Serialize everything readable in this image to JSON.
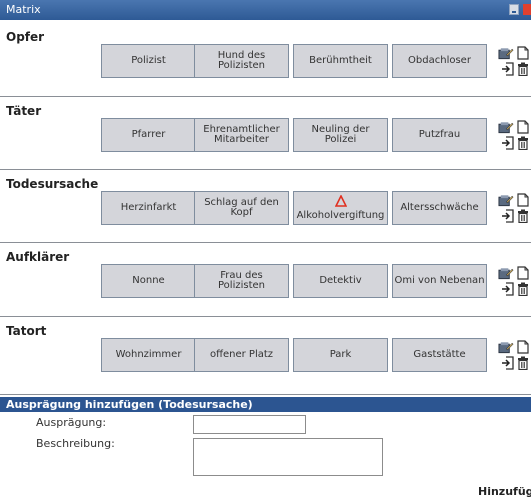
{
  "window": {
    "title": "Matrix"
  },
  "matrix": {
    "rows": [
      {
        "title": "Opfer",
        "items": [
          {
            "label": "Polizist"
          },
          {
            "label": "Hund des Polizisten"
          },
          {
            "label": "Berühmtheit"
          },
          {
            "label": "Obdachloser"
          }
        ]
      },
      {
        "title": "Täter",
        "items": [
          {
            "label": "Pfarrer"
          },
          {
            "label": "Ehrenamtlicher Mitarbeiter"
          },
          {
            "label": "Neuling der Polizei"
          },
          {
            "label": "Putzfrau"
          }
        ]
      },
      {
        "title": "Todesursache",
        "items": [
          {
            "label": "Herzinfarkt"
          },
          {
            "label": "Schlag auf den Kopf"
          },
          {
            "label": "Alkoholvergiftung",
            "warning": true
          },
          {
            "label": "Altersschwäche"
          }
        ]
      },
      {
        "title": "Aufklärer",
        "items": [
          {
            "label": "Nonne"
          },
          {
            "label": "Frau des Polizisten"
          },
          {
            "label": "Detektiv"
          },
          {
            "label": "Omi von Nebenan"
          }
        ]
      },
      {
        "title": "Tatort",
        "items": [
          {
            "label": "Wohnzimmer"
          },
          {
            "label": "offener Platz"
          },
          {
            "label": "Park"
          },
          {
            "label": "Gaststätte"
          }
        ]
      }
    ],
    "row_icons": [
      "edit-icon",
      "document-icon",
      "import-arrow-icon",
      "trash-icon"
    ]
  },
  "form": {
    "title": "Ausprägung hinzufügen (Todesursache)",
    "auspraegung_label": "Ausprägung:",
    "auspraegung_value": "",
    "beschreibung_label": "Beschreibung:",
    "beschreibung_value": "",
    "submit_label": "Hinzufügen"
  },
  "colors": {
    "titlebar": "#3a67a4",
    "form_header": "#2c5591",
    "cell_bg": "#d4d5da",
    "cell_border": "#7f8d9e",
    "warning": "#e03020"
  }
}
